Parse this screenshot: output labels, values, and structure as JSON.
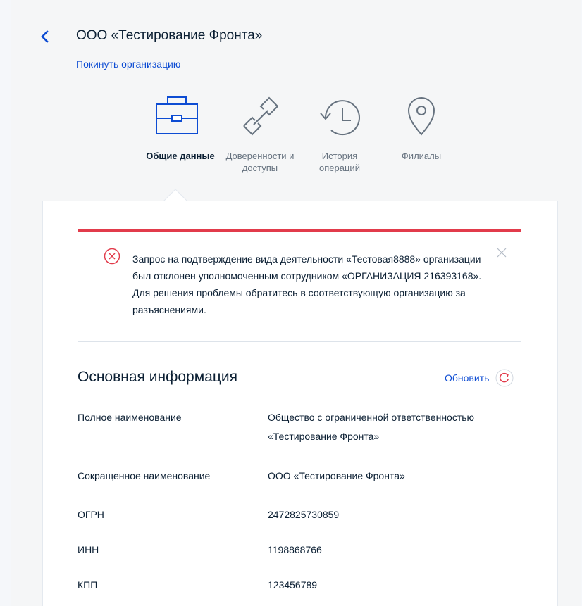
{
  "header": {
    "title": "ООО «Тестирование Фронта»",
    "leave_link": "Покинуть организацию"
  },
  "tabs": [
    {
      "label": "Общие данные",
      "icon": "briefcase-icon",
      "active": true
    },
    {
      "label": "Доверенности и доступы",
      "icon": "link-chain-icon",
      "active": false
    },
    {
      "label": "История операций",
      "icon": "history-clock-icon",
      "active": false
    },
    {
      "label": "Филиалы",
      "icon": "map-pin-icon",
      "active": false
    }
  ],
  "alert": {
    "text": "Запрос на подтверждение вида деятельности «Тестовая8888» организации был отклонен уполномоченным сотрудником «ОРГАНИЗАЦИЯ 216393168». Для решения проблемы обратитесь в соответствующую организацию за разъяснениями.",
    "icon": "error-circle-icon",
    "close_icon": "close-icon"
  },
  "main_info": {
    "title": "Основная информация",
    "refresh_label": "Обновить",
    "rows": [
      {
        "label": "Полное наименование",
        "value": "Общество с ограниченной ответственностью «Тестирование Фронта»"
      },
      {
        "label": "Сокращенное наименование",
        "value": "ООО «Тестирование Фронта»"
      },
      {
        "label": "ОГРН",
        "value": "2472825730859"
      },
      {
        "label": "ИНН",
        "value": "1198868766"
      },
      {
        "label": "КПП",
        "value": "123456789"
      }
    ]
  },
  "colors": {
    "accent": "#0d4cd3",
    "icon_blue": "#0d4cd3",
    "icon_gray": "#66727f",
    "error": "#e23b4b",
    "text": "#0b1f33",
    "muted_text": "#66727f"
  }
}
